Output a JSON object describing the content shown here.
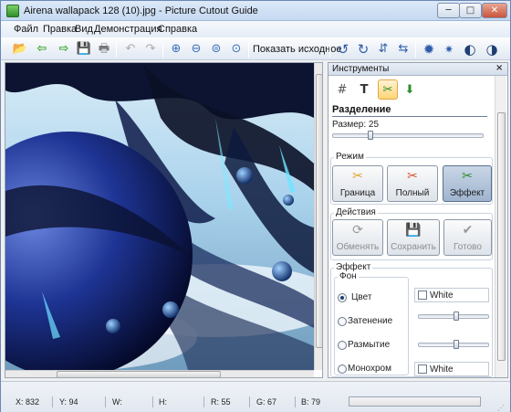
{
  "window": {
    "title": "Airena wallapack 128 (10).jpg - Picture Cutout Guide",
    "minimize": "─",
    "maximize": "□",
    "close": "✕"
  },
  "menu": [
    "Файл",
    "Правка",
    "Вид",
    "Демонстрация",
    "Справка"
  ],
  "toolbar": {
    "show_original": "Показать исходное"
  },
  "icons": {
    "open": "📂",
    "back": "⇦",
    "forward": "⇨",
    "save": "💾",
    "print": "🖶",
    "undo": "↶",
    "redo": "↷",
    "zoom_in": "⊕",
    "zoom_out": "⊖",
    "zoom_fit": "⊜",
    "zoom_actual": "⊙",
    "rotate_left": "↺",
    "rotate_right": "↻",
    "flip_v": "⇵",
    "flip_h": "⇆",
    "settings": "✹",
    "settings2": "✷",
    "contrast": "◐",
    "contrast2": "◑",
    "grid": "#",
    "text": "T",
    "cutout": "✂",
    "restore": "⬇",
    "refresh": "⟳",
    "save2": "💾",
    "check": "✔"
  },
  "panel": {
    "title": "Инструменты",
    "close": "×",
    "separation_title": "Разделение",
    "size_label": "Размер: 25",
    "size_value": 25,
    "mode_title": "Режим",
    "mode_buttons": [
      "Граница",
      "Полный",
      "Эффект"
    ],
    "mode_active": "Эффект",
    "actions_title": "Действия",
    "action_buttons": [
      "Обменять",
      "Сохранить",
      "Готово"
    ],
    "effect_title": "Эффект",
    "background_label": "Фон",
    "options": [
      "Цвет",
      "Затенение",
      "Размытие",
      "Монохром"
    ],
    "selected_option": "Цвет",
    "color_top": "White",
    "color_bottom": "White"
  },
  "status": {
    "x": "X: 832",
    "y": "Y: 94",
    "w": "W:",
    "h": "H:",
    "r": "R: 55",
    "g": "G: 67",
    "b": "B: 79",
    "progress": 0.0
  },
  "colors": {
    "accent": "#e2a744",
    "sky": "#a9d2ec",
    "sphere": "#1a2f8a"
  }
}
